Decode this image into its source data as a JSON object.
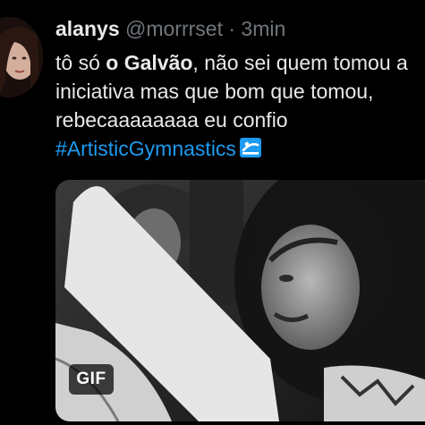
{
  "tweet": {
    "author_name": "alanys",
    "author_handle": "@morrrset",
    "separator": "·",
    "time": "3min",
    "text_lines": {
      "l1_pre": "tô só ",
      "l1_bold": "o Galvão",
      "l1_post": ", não sei quem tomou a",
      "l2": "iniciativa mas que bom que tomou,",
      "l3": "rebecaaaaaaaa eu confio"
    },
    "hashtag": "#ArtisticGymnastics",
    "hashtag_emoji_icon": "gymnast-pictogram-icon",
    "media": {
      "type_badge": "GIF",
      "description_icon": "gif-media"
    }
  },
  "colors": {
    "background": "#000000",
    "text": "#e7e9ea",
    "secondary": "#71767b",
    "link": "#1d9bf0"
  }
}
